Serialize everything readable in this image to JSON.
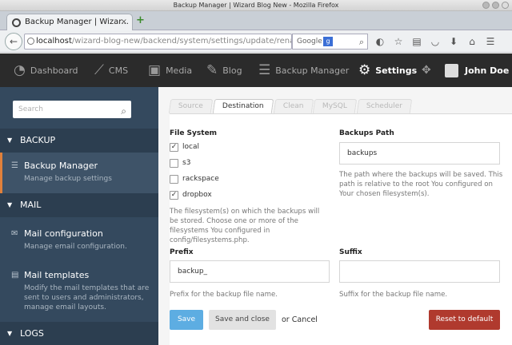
{
  "window": {
    "title": "Backup Manager | Wizard Blog New - Mozilla Firefox"
  },
  "browser": {
    "tab_title": "Backup Manager | Wizar...",
    "url_host": "localhost",
    "url_path": "/wizard-blog-new/backend/system/settings/update/renatio/backup",
    "search_engine": "Google"
  },
  "appnav": {
    "items": [
      {
        "label": "Dashboard"
      },
      {
        "label": "CMS"
      },
      {
        "label": "Media"
      },
      {
        "label": "Blog"
      },
      {
        "label": "Backup Manager"
      },
      {
        "label": "Settings"
      }
    ],
    "user": "John Doe"
  },
  "sidebar": {
    "search_placeholder": "Search",
    "sections": [
      {
        "label": "BACKUP"
      },
      {
        "label": "MAIL"
      },
      {
        "label": "LOGS"
      }
    ],
    "items": [
      {
        "label": "Backup Manager",
        "desc": "Manage backup settings"
      },
      {
        "label": "Mail configuration",
        "desc": "Manage email configuration."
      },
      {
        "label": "Mail templates",
        "desc": "Modify the mail templates that are sent to users and administrators, manage email layouts."
      }
    ]
  },
  "tabs": [
    "Source",
    "Destination",
    "Clean",
    "MySQL",
    "Scheduler"
  ],
  "active_tab": "Destination",
  "form": {
    "filesystem_label": "File System",
    "filesystems": [
      {
        "label": "local",
        "checked": true
      },
      {
        "label": "s3",
        "checked": false
      },
      {
        "label": "rackspace",
        "checked": false
      },
      {
        "label": "dropbox",
        "checked": true
      }
    ],
    "filesystem_help": "The filesystem(s) on which the backups will be stored. Choose one or more of the filesystems You configured in config/filesystems.php.",
    "path_label": "Backups Path",
    "path_value": "backups",
    "path_help": "The path where the backups will be saved. This path is relative to the root You configured on Your chosen filesystem(s).",
    "prefix_label": "Prefix",
    "prefix_value": "backup_",
    "prefix_help": "Prefix for the backup file name.",
    "suffix_label": "Suffix",
    "suffix_value": "",
    "suffix_help": "Suffix for the backup file name."
  },
  "buttons": {
    "save": "Save",
    "save_close": "Save and close",
    "or": "or",
    "cancel": "Cancel",
    "reset": "Reset to default"
  },
  "colors": {
    "topbar": "#2b2b2b",
    "sidebar": "#34495e",
    "sidebar_section": "#2c3e50",
    "active_marker": "#e0803b",
    "save": "#5dade2",
    "reset": "#b03a2e"
  }
}
